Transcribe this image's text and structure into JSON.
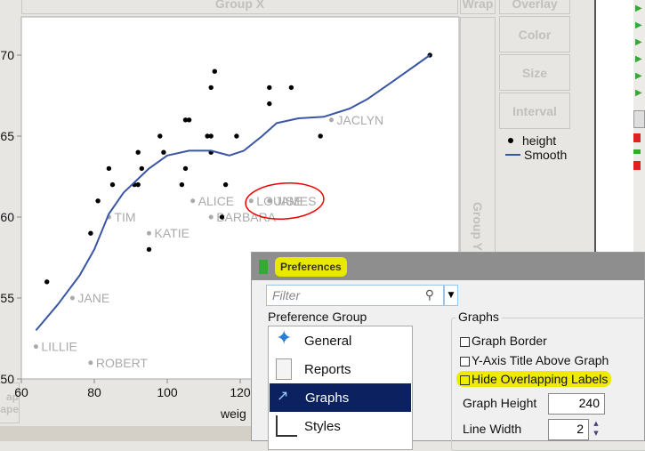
{
  "drop_zones": {
    "group_x": "Group X",
    "wrap": "Wrap",
    "overlay": "Overlay",
    "color": "Color",
    "size": "Size",
    "interval": "Interval",
    "group_y": "Group Y",
    "map_shape_a": "ap",
    "map_shape_b": "ape"
  },
  "chart_data": {
    "type": "scatter",
    "xlabel": "weig",
    "xlim": [
      60,
      180
    ],
    "ylim": [
      50,
      72.4
    ],
    "x_ticks": [
      "60",
      "80",
      "100",
      "120"
    ],
    "y_ticks": [
      "50",
      "55",
      "60",
      "65",
      "70"
    ],
    "legend": [
      {
        "name": "height",
        "marker": "dot"
      },
      {
        "name": "Smooth",
        "marker": "line",
        "color": "#3a55a4"
      }
    ],
    "points": [
      [
        81,
        61
      ],
      [
        84,
        63
      ],
      [
        85,
        62
      ],
      [
        91,
        62
      ],
      [
        92,
        62
      ],
      [
        92,
        64
      ],
      [
        93,
        63
      ],
      [
        98,
        65
      ],
      [
        99,
        64
      ],
      [
        104,
        62
      ],
      [
        105,
        63
      ],
      [
        105,
        66
      ],
      [
        106,
        66
      ],
      [
        111,
        65
      ],
      [
        112,
        65
      ],
      [
        112,
        64
      ],
      [
        112,
        68
      ],
      [
        113,
        69
      ],
      [
        116,
        62
      ],
      [
        115,
        60
      ],
      [
        119,
        65
      ],
      [
        128,
        68
      ],
      [
        128,
        67
      ],
      [
        134,
        68
      ],
      [
        142,
        65
      ],
      [
        172,
        70
      ],
      [
        79,
        59
      ],
      [
        67,
        56
      ],
      [
        95,
        58
      ]
    ],
    "labeled_points": [
      {
        "name": "TIM",
        "x": 84,
        "y": 60
      },
      {
        "name": "KATIE",
        "x": 95,
        "y": 59
      },
      {
        "name": "JANE",
        "x": 74,
        "y": 55
      },
      {
        "name": "LILLIE",
        "x": 64,
        "y": 52
      },
      {
        "name": "ROBERT",
        "x": 79,
        "y": 51
      },
      {
        "name": "BARBARA",
        "x": 112,
        "y": 60
      },
      {
        "name": "ALICE",
        "x": 107,
        "y": 61
      },
      {
        "name": "LOUISE",
        "x": 123,
        "y": 61
      },
      {
        "name": "JAMES",
        "x": 128,
        "y": 61
      },
      {
        "name": "JACLYN",
        "x": 145,
        "y": 66
      }
    ],
    "smooth": [
      [
        64,
        53
      ],
      [
        70,
        54.6
      ],
      [
        76,
        56.4
      ],
      [
        80,
        58
      ],
      [
        84,
        60.2
      ],
      [
        88,
        61.5
      ],
      [
        95,
        63
      ],
      [
        100,
        63.8
      ],
      [
        106,
        64.1
      ],
      [
        112,
        64.1
      ],
      [
        117,
        63.8
      ],
      [
        121,
        64.1
      ],
      [
        126,
        65
      ],
      [
        130,
        65.8
      ],
      [
        136,
        66.1
      ],
      [
        143,
        66.2
      ],
      [
        150,
        66.7
      ],
      [
        155,
        67.3
      ],
      [
        162,
        68.4
      ],
      [
        172,
        70
      ]
    ]
  },
  "dialog": {
    "title": "Preferences",
    "filter_placeholder": "Filter",
    "group_label": "Preference Group",
    "groups": [
      {
        "label": "General"
      },
      {
        "label": "Reports"
      },
      {
        "label": "Graphs",
        "selected": true
      },
      {
        "label": "Styles"
      }
    ],
    "section_title": "Graphs",
    "graph_border": "Graph Border",
    "y_axis_title": "Y-Axis Title Above Graph",
    "hide_overlapping": "Hide Overlapping Labels",
    "graph_height_label": "Graph Height",
    "graph_height": "240",
    "line_width_label": "Line Width",
    "line_width": "2"
  }
}
